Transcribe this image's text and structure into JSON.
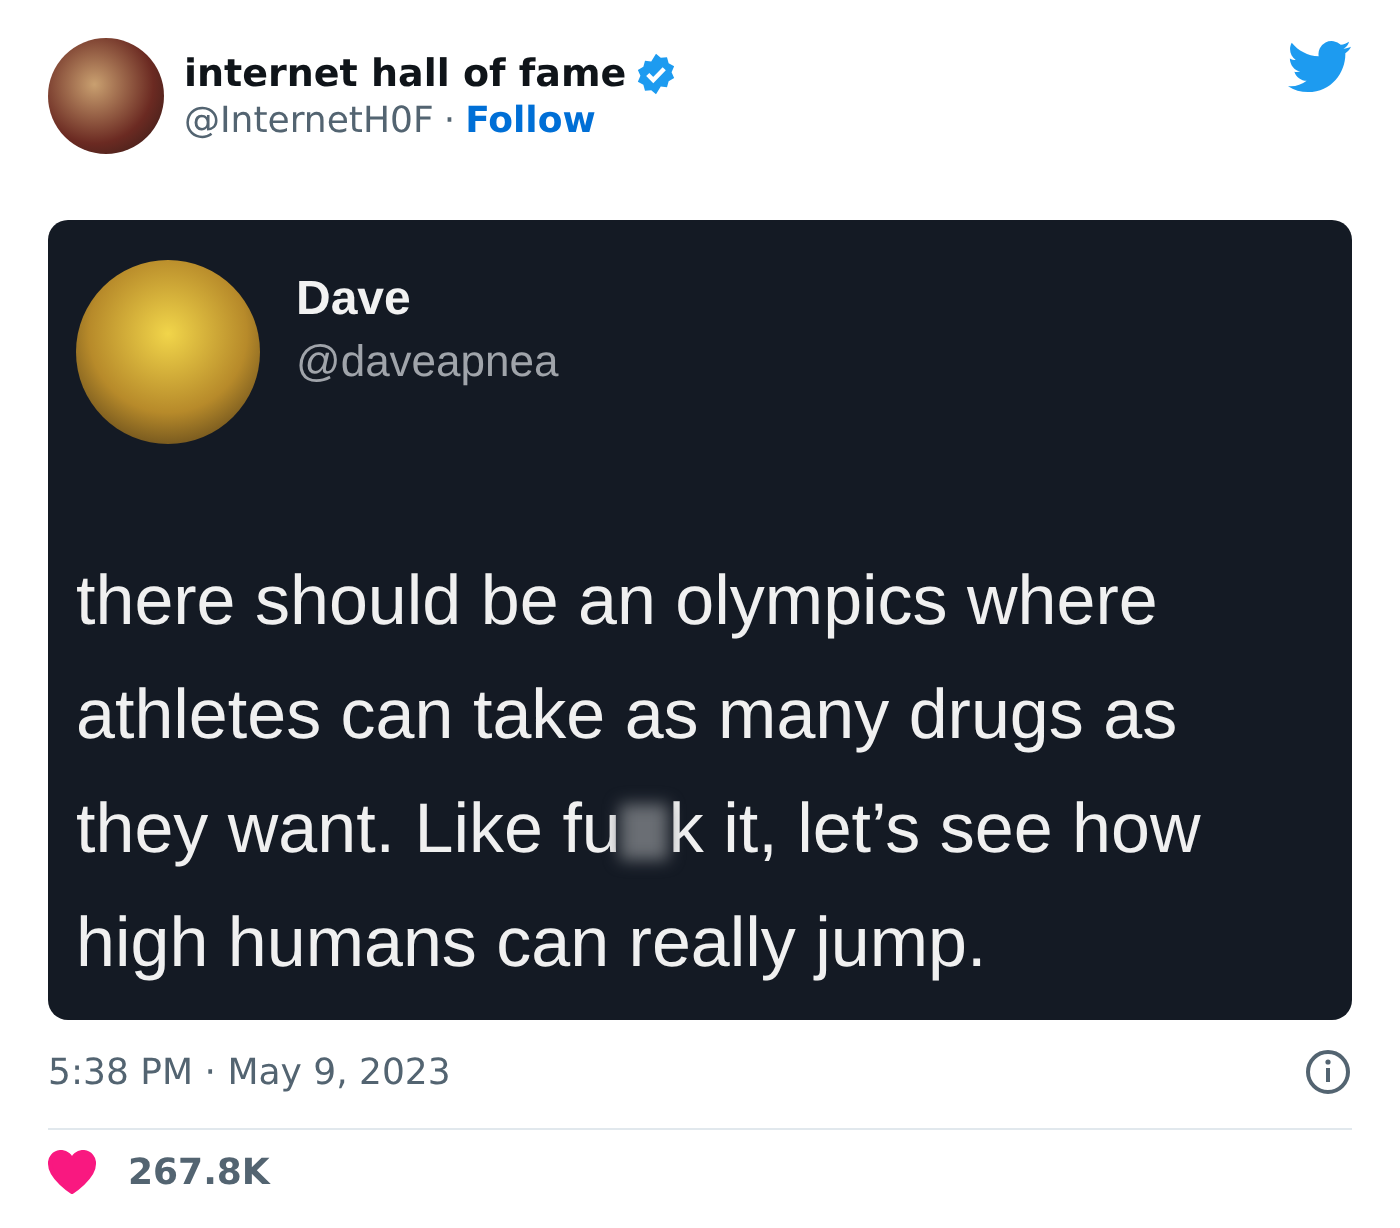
{
  "author": {
    "name": "internet hall of fame",
    "verified": true,
    "handle": "@InternetH0F",
    "separator": "·",
    "follow": "Follow"
  },
  "embedded_post": {
    "name": "Dave",
    "handle": "@daveapnea",
    "lines": [
      {
        "text": "there should be an olympics where"
      },
      {
        "text": "athletes can take as many drugs as"
      },
      {
        "text": "they want. Like fu",
        "censored": true,
        "after": "k it, let’s see how"
      },
      {
        "text": "high humans can really jump."
      }
    ]
  },
  "timestamp": "5:38 PM · May 9, 2023",
  "likes": {
    "count": "267.8K",
    "liked": true
  }
}
